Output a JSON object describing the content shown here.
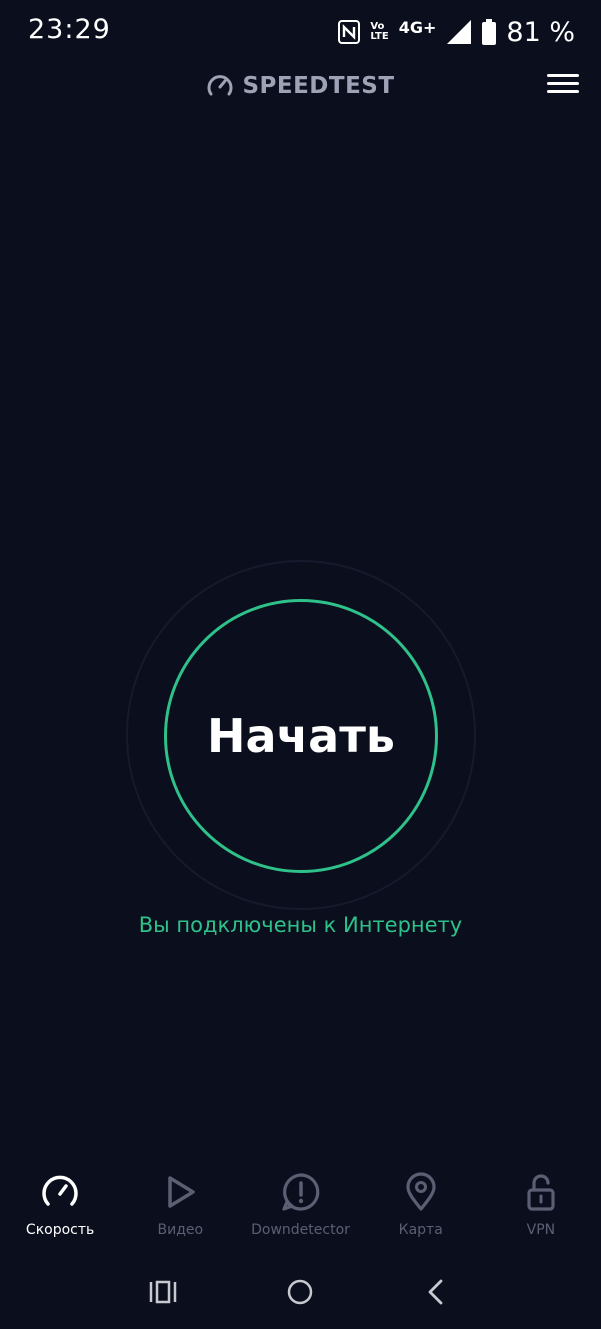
{
  "status_bar": {
    "time": "23:29",
    "volte_top": "Vo",
    "volte_bottom": "LTE",
    "network": "4G+",
    "battery": "81 %"
  },
  "header": {
    "logo_text": "SPEEDTEST",
    "logo_icon": "speedometer-icon",
    "menu_icon": "hamburger-menu-icon"
  },
  "main": {
    "start_label": "Начать",
    "connection_status": "Вы подключены к Интернету"
  },
  "colors": {
    "background": "#0b0e1d",
    "accent": "#2ec28a",
    "inactive": "#5b5f73"
  },
  "nav": {
    "items": [
      {
        "label": "Скорость",
        "icon": "speedometer-icon",
        "active": true
      },
      {
        "label": "Видео",
        "icon": "play-icon",
        "active": false
      },
      {
        "label": "Downdetector",
        "icon": "alert-icon",
        "active": false
      },
      {
        "label": "Карта",
        "icon": "map-pin-icon",
        "active": false
      },
      {
        "label": "VPN",
        "icon": "unlock-icon",
        "active": false
      }
    ]
  },
  "system_nav": {
    "recents_icon": "recents-icon",
    "home_icon": "home-icon",
    "back_icon": "back-icon"
  }
}
